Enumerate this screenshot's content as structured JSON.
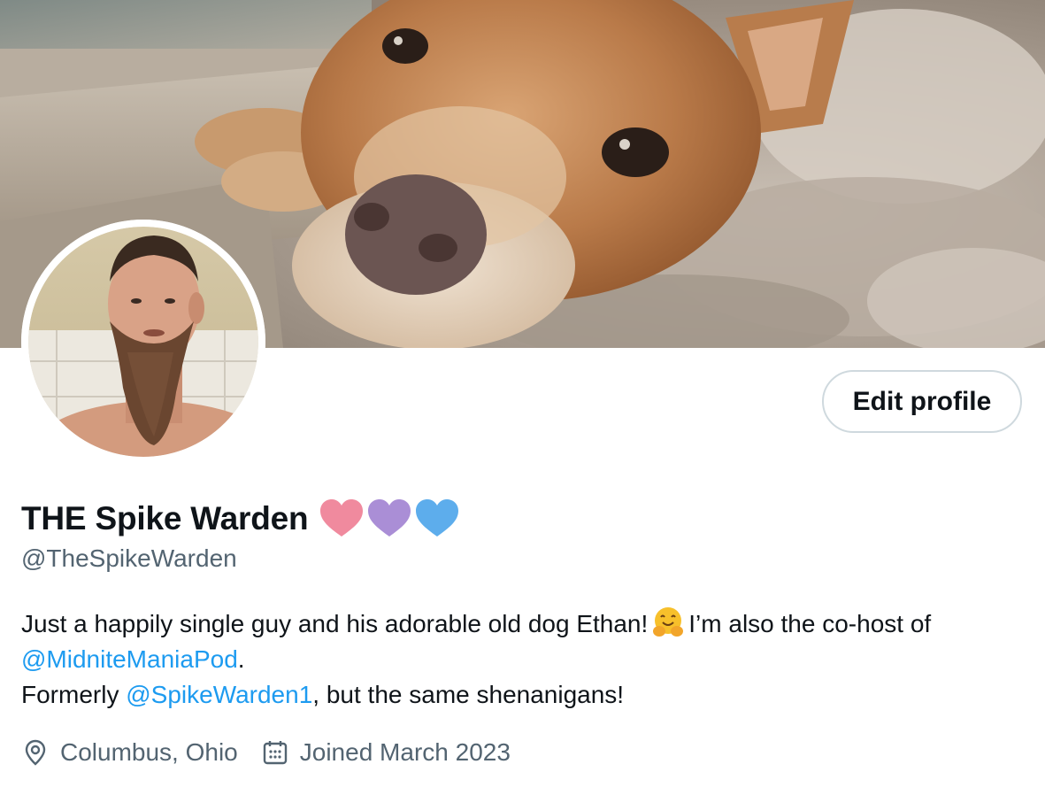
{
  "profile": {
    "display_name": "THE Spike Warden",
    "name_hearts": [
      "pink-heart",
      "purple-heart",
      "blue-heart"
    ],
    "handle": "@TheSpikeWarden",
    "edit_profile_label": "Edit profile",
    "bio": {
      "line1_text": "Just a happily single guy and his adorable old dog Ethan!",
      "line1_emoji": "hugging-face",
      "line1_rest": "I’m also the co-host of",
      "line2_mention": "@MidniteManiaPod",
      "line2_tail": ".",
      "line3_prefix": "Formerly ",
      "line3_mention": "@SpikeWarden1",
      "line3_tail": ", but the same shenanigans!"
    },
    "location": "Columbus, Ohio",
    "joined": "Joined March 2023"
  },
  "icons": {
    "location": "location-pin-icon",
    "joined": "calendar-icon"
  },
  "colors": {
    "link": "#1d9bf0",
    "secondary_text": "#536471",
    "primary_text": "#0f1419",
    "button_border": "#cfd9de",
    "heart_pink": "#f08a9e",
    "heart_purple": "#aa8ed6",
    "heart_blue": "#5dadec"
  }
}
